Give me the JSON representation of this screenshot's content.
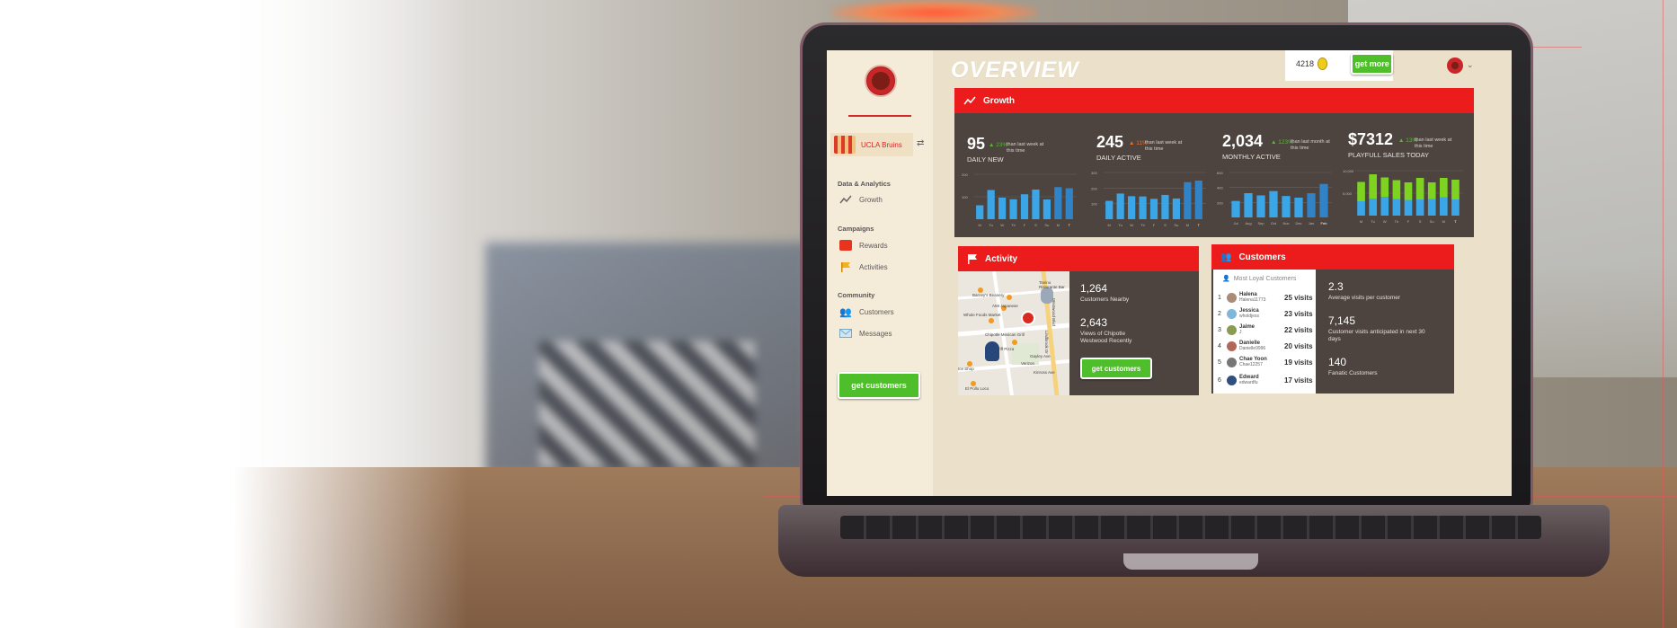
{
  "sidebar": {
    "store": "UCLA Bruins",
    "sections": [
      {
        "title": "Data & Analytics",
        "items": [
          {
            "label": "Growth",
            "icon": "trend-up-icon"
          }
        ]
      },
      {
        "title": "Campaigns",
        "items": [
          {
            "label": "Rewards",
            "icon": "rewards-icon"
          },
          {
            "label": "Activities",
            "icon": "flag-icon"
          }
        ]
      },
      {
        "title": "Community",
        "items": [
          {
            "label": "Customers",
            "icon": "people-icon"
          },
          {
            "label": "Messages",
            "icon": "envelope-icon"
          }
        ]
      }
    ],
    "cta": "get customers"
  },
  "header": {
    "title": "OVERVIEW",
    "coins": "4218",
    "get_more": "get more"
  },
  "growth": {
    "title": "Growth",
    "stats": [
      {
        "value": "95",
        "change": "23%",
        "note": "than last week at this time",
        "label": "DAILY NEW",
        "change_color": "#4fbe2b"
      },
      {
        "value": "245",
        "change": "11%",
        "note": "than last week at this time",
        "label": "DAILY ACTIVE",
        "change_color": "#f26b1e"
      },
      {
        "value": "2,034",
        "change": "123%",
        "note": "than last month at this time",
        "label": "MONTHLY ACTIVE",
        "change_color": "#4fbe2b"
      },
      {
        "value": "$7312",
        "change": "13%",
        "note": "than last week at this time",
        "label": "PLAYFULL SALES TODAY",
        "change_color": "#4fbe2b"
      }
    ]
  },
  "chart_data": [
    {
      "type": "bar",
      "categories": [
        "M",
        "Tu",
        "W",
        "Th",
        "F",
        "S",
        "Su",
        "M",
        "T"
      ],
      "values": [
        62,
        130,
        96,
        89,
        111,
        132,
        88,
        143,
        138
      ],
      "ylim": [
        0,
        200
      ],
      "yticks": [
        "200",
        "100"
      ]
    },
    {
      "type": "bar",
      "categories": [
        "M",
        "Tu",
        "W",
        "Th",
        "F",
        "S",
        "Su",
        "M",
        "T"
      ],
      "values": [
        118,
        165,
        148,
        146,
        131,
        156,
        133,
        238,
        248
      ],
      "ylim": [
        0,
        300
      ],
      "yticks": [
        "300",
        "200",
        "100"
      ]
    },
    {
      "type": "bar",
      "categories": [
        "Jul",
        "Aug",
        "Sep",
        "Oct",
        "Nov",
        "Dec",
        "Jan",
        "Feb"
      ],
      "values": [
        220,
        324,
        294,
        352,
        286,
        264,
        323,
        447
      ],
      "ylim": [
        0,
        600
      ],
      "yticks": [
        "600",
        "400",
        "200"
      ]
    },
    {
      "type": "bar",
      "categories": [
        "M",
        "Tu",
        "W",
        "Th",
        "F",
        "S",
        "Su",
        "M",
        "T"
      ],
      "series": [
        {
          "values": [
            3200,
            3800,
            4200,
            3700,
            3500,
            3600,
            3700,
            4100,
            3600
          ],
          "color": "#3aa6e8"
        },
        {
          "values": [
            4300,
            5400,
            4300,
            4200,
            3900,
            4800,
            3700,
            4300,
            4400
          ],
          "color": "#7ed321"
        }
      ],
      "ylim": [
        0,
        10000
      ],
      "yticks": [
        "10,000",
        "5,000"
      ]
    }
  ],
  "activity": {
    "title": "Activity",
    "stats": [
      {
        "value": "1,264",
        "label": "Customers Nearby"
      },
      {
        "value": "2,643",
        "label": "Views of Chipotle Westwood Recently"
      }
    ],
    "cta": "get customers",
    "map_labels": [
      "Barney's Beanery",
      "AMI Japanese",
      "Whole Foods Market",
      "Chipotle Mexican Grill",
      "Tanino Ristorante Bar",
      "Westwood Blvd",
      "Gayley Ave",
      "Lindbrook Dr",
      "Kinross Ave",
      "Verizon",
      "Tiff Pizza",
      "Ice Shop",
      "El Pollo Loco"
    ]
  },
  "customers": {
    "title": "Customers",
    "loyal_title": "Most Loyal Customers",
    "list": [
      {
        "rank": "1",
        "name": "Halena",
        "handle": "Halena11773",
        "visits": "25 visits"
      },
      {
        "rank": "2",
        "name": "Jessica",
        "handle": "wholdjess",
        "visits": "23 visits"
      },
      {
        "rank": "3",
        "name": "Jaime",
        "handle": "J",
        "visits": "22 visits"
      },
      {
        "rank": "4",
        "name": "Danielle",
        "handle": "Danielle9996",
        "visits": "20 visits"
      },
      {
        "rank": "5",
        "name": "Chae Yoon",
        "handle": "Chae12257",
        "visits": "19 visits"
      },
      {
        "rank": "6",
        "name": "Edward",
        "handle": "edwardfu",
        "visits": "17 visits"
      }
    ],
    "stats": [
      {
        "value": "2.3",
        "label": "Average visits per customer"
      },
      {
        "value": "7,145",
        "label": "Customer visits anticipated in next 30 days"
      },
      {
        "value": "140",
        "label": "Fanatic Customers"
      }
    ]
  }
}
